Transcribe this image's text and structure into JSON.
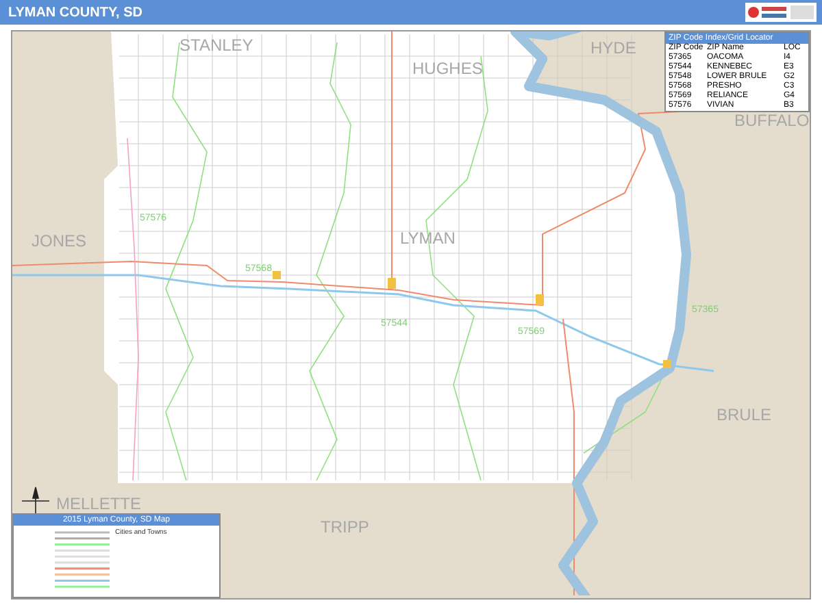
{
  "title": "LYMAN COUNTY, SD",
  "map_labels": [
    {
      "text": "STANLEY",
      "kind": "county"
    },
    {
      "text": "HUGHES",
      "kind": "county"
    },
    {
      "text": "HYDE",
      "kind": "county"
    },
    {
      "text": "BUFFALO",
      "kind": "county"
    },
    {
      "text": "JONES",
      "kind": "county"
    },
    {
      "text": "LYMAN",
      "kind": "county"
    },
    {
      "text": "BRULE",
      "kind": "county"
    },
    {
      "text": "MELLETTE",
      "kind": "county"
    },
    {
      "text": "TRIPP",
      "kind": "county"
    },
    {
      "text": "57576",
      "kind": "zip"
    },
    {
      "text": "57568",
      "kind": "zip"
    },
    {
      "text": "57544",
      "kind": "zip"
    },
    {
      "text": "57569",
      "kind": "zip"
    },
    {
      "text": "57365",
      "kind": "zip"
    }
  ],
  "zip_index": {
    "title": "ZIP Code Index/Grid Locator",
    "columns": [
      "ZIP Code",
      "ZIP Name",
      "LOC"
    ],
    "rows": [
      [
        "57365",
        "OACOMA",
        "I4"
      ],
      [
        "57544",
        "KENNEBEC",
        "E3"
      ],
      [
        "57548",
        "LOWER BRULE",
        "G2"
      ],
      [
        "57568",
        "PRESHO",
        "C3"
      ],
      [
        "57569",
        "RELIANCE",
        "G4"
      ],
      [
        "57576",
        "VIVIAN",
        "B3"
      ]
    ]
  },
  "legend": {
    "title": "2015 Lyman County, SD Map",
    "heading": "Cities and Towns"
  }
}
